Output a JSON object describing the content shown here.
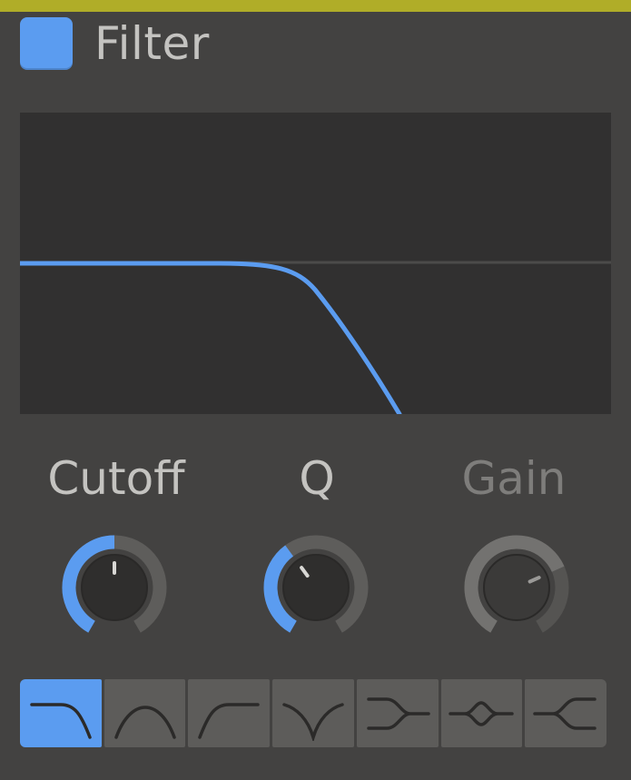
{
  "colors": {
    "accent_bar": "#b0ad28",
    "active_blue": "#5b9cf0",
    "panel": "#434241",
    "graph_bg": "#313030"
  },
  "module": {
    "title": "Filter",
    "enabled": true
  },
  "knobs": {
    "cutoff": {
      "label": "Cutoff",
      "value": 0.5,
      "enabled": true
    },
    "q": {
      "label": "Q",
      "value": 0.38,
      "enabled": true
    },
    "gain": {
      "label": "Gain",
      "value": 0.72,
      "enabled": false
    }
  },
  "filter_types": [
    {
      "icon": "lowpass-icon",
      "active": true
    },
    {
      "icon": "bandpass-icon",
      "active": false
    },
    {
      "icon": "highpass-icon",
      "active": false
    },
    {
      "icon": "notch-icon",
      "active": false
    },
    {
      "icon": "low-shelf-icon",
      "active": false
    },
    {
      "icon": "peak-icon",
      "active": false
    },
    {
      "icon": "high-shelf-icon",
      "active": false
    }
  ]
}
